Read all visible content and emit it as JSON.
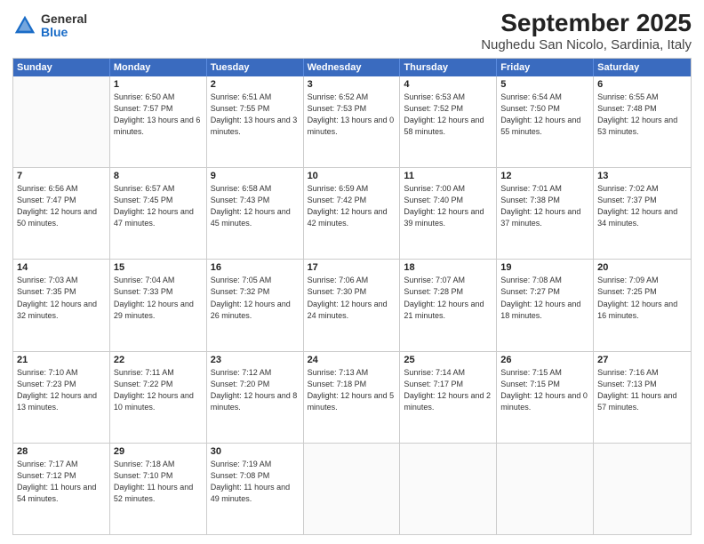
{
  "header": {
    "logo_general": "General",
    "logo_blue": "Blue",
    "title": "September 2025",
    "subtitle": "Nughedu San Nicolo, Sardinia, Italy"
  },
  "days_of_week": [
    "Sunday",
    "Monday",
    "Tuesday",
    "Wednesday",
    "Thursday",
    "Friday",
    "Saturday"
  ],
  "weeks": [
    [
      {
        "day": "",
        "sunrise": "",
        "sunset": "",
        "daylight": ""
      },
      {
        "day": "1",
        "sunrise": "Sunrise: 6:50 AM",
        "sunset": "Sunset: 7:57 PM",
        "daylight": "Daylight: 13 hours and 6 minutes."
      },
      {
        "day": "2",
        "sunrise": "Sunrise: 6:51 AM",
        "sunset": "Sunset: 7:55 PM",
        "daylight": "Daylight: 13 hours and 3 minutes."
      },
      {
        "day": "3",
        "sunrise": "Sunrise: 6:52 AM",
        "sunset": "Sunset: 7:53 PM",
        "daylight": "Daylight: 13 hours and 0 minutes."
      },
      {
        "day": "4",
        "sunrise": "Sunrise: 6:53 AM",
        "sunset": "Sunset: 7:52 PM",
        "daylight": "Daylight: 12 hours and 58 minutes."
      },
      {
        "day": "5",
        "sunrise": "Sunrise: 6:54 AM",
        "sunset": "Sunset: 7:50 PM",
        "daylight": "Daylight: 12 hours and 55 minutes."
      },
      {
        "day": "6",
        "sunrise": "Sunrise: 6:55 AM",
        "sunset": "Sunset: 7:48 PM",
        "daylight": "Daylight: 12 hours and 53 minutes."
      }
    ],
    [
      {
        "day": "7",
        "sunrise": "Sunrise: 6:56 AM",
        "sunset": "Sunset: 7:47 PM",
        "daylight": "Daylight: 12 hours and 50 minutes."
      },
      {
        "day": "8",
        "sunrise": "Sunrise: 6:57 AM",
        "sunset": "Sunset: 7:45 PM",
        "daylight": "Daylight: 12 hours and 47 minutes."
      },
      {
        "day": "9",
        "sunrise": "Sunrise: 6:58 AM",
        "sunset": "Sunset: 7:43 PM",
        "daylight": "Daylight: 12 hours and 45 minutes."
      },
      {
        "day": "10",
        "sunrise": "Sunrise: 6:59 AM",
        "sunset": "Sunset: 7:42 PM",
        "daylight": "Daylight: 12 hours and 42 minutes."
      },
      {
        "day": "11",
        "sunrise": "Sunrise: 7:00 AM",
        "sunset": "Sunset: 7:40 PM",
        "daylight": "Daylight: 12 hours and 39 minutes."
      },
      {
        "day": "12",
        "sunrise": "Sunrise: 7:01 AM",
        "sunset": "Sunset: 7:38 PM",
        "daylight": "Daylight: 12 hours and 37 minutes."
      },
      {
        "day": "13",
        "sunrise": "Sunrise: 7:02 AM",
        "sunset": "Sunset: 7:37 PM",
        "daylight": "Daylight: 12 hours and 34 minutes."
      }
    ],
    [
      {
        "day": "14",
        "sunrise": "Sunrise: 7:03 AM",
        "sunset": "Sunset: 7:35 PM",
        "daylight": "Daylight: 12 hours and 32 minutes."
      },
      {
        "day": "15",
        "sunrise": "Sunrise: 7:04 AM",
        "sunset": "Sunset: 7:33 PM",
        "daylight": "Daylight: 12 hours and 29 minutes."
      },
      {
        "day": "16",
        "sunrise": "Sunrise: 7:05 AM",
        "sunset": "Sunset: 7:32 PM",
        "daylight": "Daylight: 12 hours and 26 minutes."
      },
      {
        "day": "17",
        "sunrise": "Sunrise: 7:06 AM",
        "sunset": "Sunset: 7:30 PM",
        "daylight": "Daylight: 12 hours and 24 minutes."
      },
      {
        "day": "18",
        "sunrise": "Sunrise: 7:07 AM",
        "sunset": "Sunset: 7:28 PM",
        "daylight": "Daylight: 12 hours and 21 minutes."
      },
      {
        "day": "19",
        "sunrise": "Sunrise: 7:08 AM",
        "sunset": "Sunset: 7:27 PM",
        "daylight": "Daylight: 12 hours and 18 minutes."
      },
      {
        "day": "20",
        "sunrise": "Sunrise: 7:09 AM",
        "sunset": "Sunset: 7:25 PM",
        "daylight": "Daylight: 12 hours and 16 minutes."
      }
    ],
    [
      {
        "day": "21",
        "sunrise": "Sunrise: 7:10 AM",
        "sunset": "Sunset: 7:23 PM",
        "daylight": "Daylight: 12 hours and 13 minutes."
      },
      {
        "day": "22",
        "sunrise": "Sunrise: 7:11 AM",
        "sunset": "Sunset: 7:22 PM",
        "daylight": "Daylight: 12 hours and 10 minutes."
      },
      {
        "day": "23",
        "sunrise": "Sunrise: 7:12 AM",
        "sunset": "Sunset: 7:20 PM",
        "daylight": "Daylight: 12 hours and 8 minutes."
      },
      {
        "day": "24",
        "sunrise": "Sunrise: 7:13 AM",
        "sunset": "Sunset: 7:18 PM",
        "daylight": "Daylight: 12 hours and 5 minutes."
      },
      {
        "day": "25",
        "sunrise": "Sunrise: 7:14 AM",
        "sunset": "Sunset: 7:17 PM",
        "daylight": "Daylight: 12 hours and 2 minutes."
      },
      {
        "day": "26",
        "sunrise": "Sunrise: 7:15 AM",
        "sunset": "Sunset: 7:15 PM",
        "daylight": "Daylight: 12 hours and 0 minutes."
      },
      {
        "day": "27",
        "sunrise": "Sunrise: 7:16 AM",
        "sunset": "Sunset: 7:13 PM",
        "daylight": "Daylight: 11 hours and 57 minutes."
      }
    ],
    [
      {
        "day": "28",
        "sunrise": "Sunrise: 7:17 AM",
        "sunset": "Sunset: 7:12 PM",
        "daylight": "Daylight: 11 hours and 54 minutes."
      },
      {
        "day": "29",
        "sunrise": "Sunrise: 7:18 AM",
        "sunset": "Sunset: 7:10 PM",
        "daylight": "Daylight: 11 hours and 52 minutes."
      },
      {
        "day": "30",
        "sunrise": "Sunrise: 7:19 AM",
        "sunset": "Sunset: 7:08 PM",
        "daylight": "Daylight: 11 hours and 49 minutes."
      },
      {
        "day": "",
        "sunrise": "",
        "sunset": "",
        "daylight": ""
      },
      {
        "day": "",
        "sunrise": "",
        "sunset": "",
        "daylight": ""
      },
      {
        "day": "",
        "sunrise": "",
        "sunset": "",
        "daylight": ""
      },
      {
        "day": "",
        "sunrise": "",
        "sunset": "",
        "daylight": ""
      }
    ]
  ]
}
